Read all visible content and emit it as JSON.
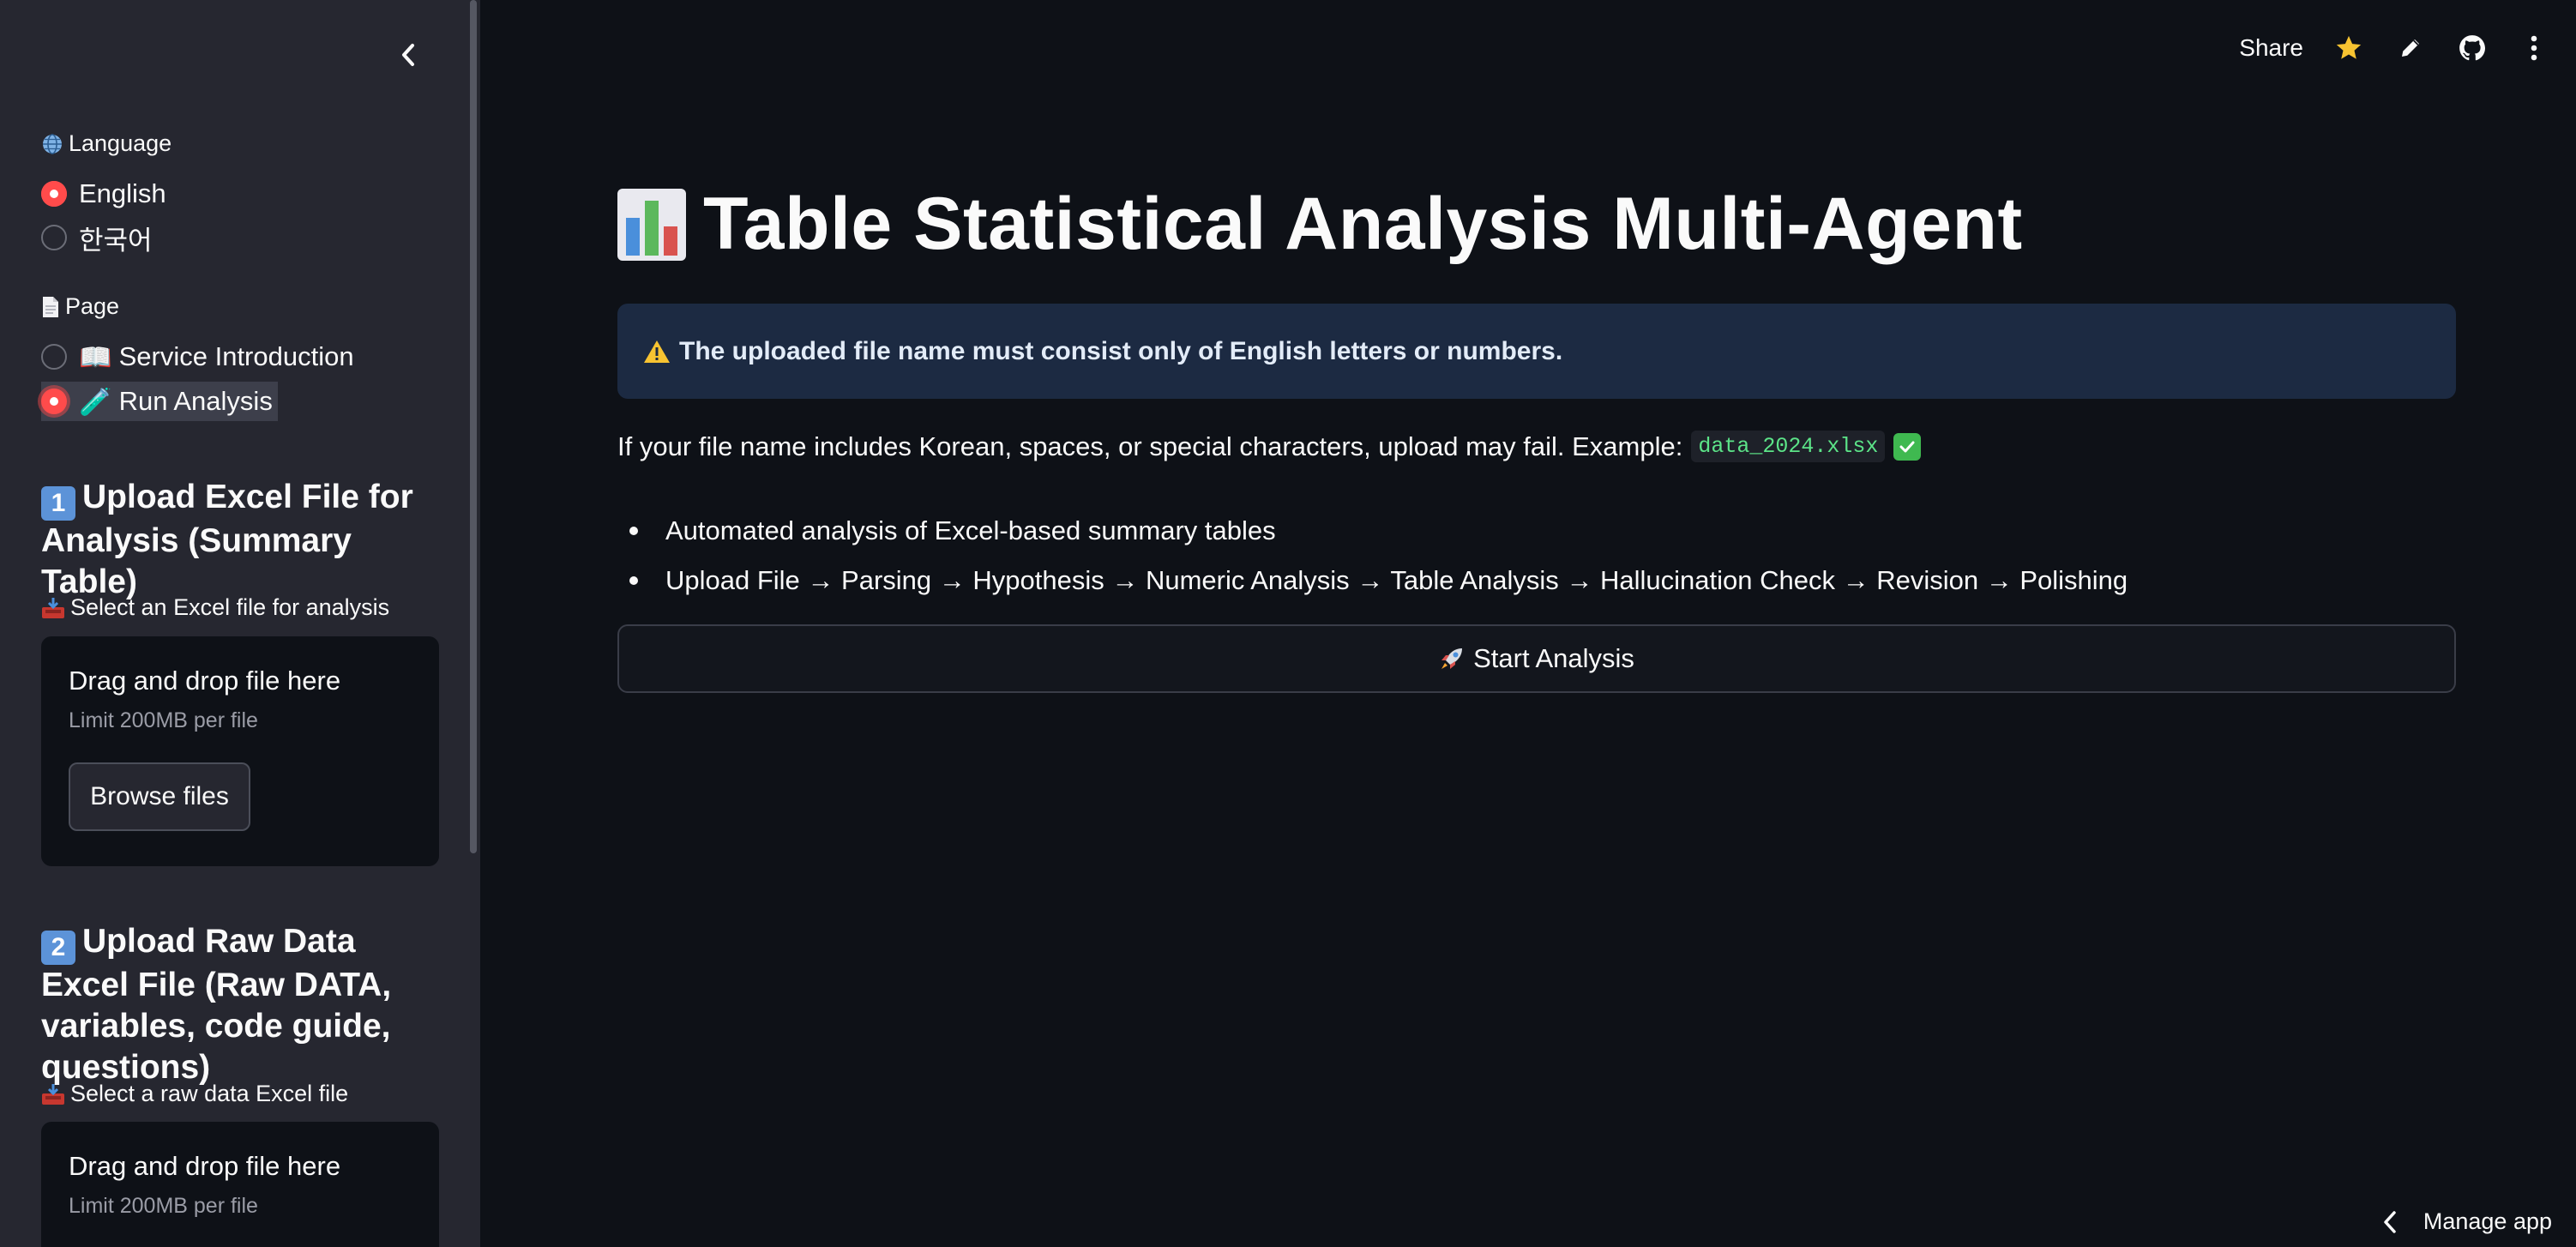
{
  "sidebar": {
    "language_label": "Language",
    "languages": [
      {
        "label": "English",
        "selected": true
      },
      {
        "label": "한국어",
        "selected": false
      }
    ],
    "page_label": "Page",
    "pages": [
      {
        "icon": "📖",
        "label": "Service Introduction",
        "selected": false
      },
      {
        "icon": "🧪",
        "label": "Run Analysis",
        "selected": true
      }
    ],
    "section1": {
      "number": "1",
      "heading": "Upload Excel File for Analysis (Summary Table)",
      "uploader_label": "Select an Excel file for analysis",
      "drop_text": "Drag and drop file here",
      "limit_text": "Limit 200MB per file",
      "browse_label": "Browse files"
    },
    "section2": {
      "number": "2",
      "heading": "Upload Raw Data Excel File (Raw DATA, variables, code guide, questions)",
      "uploader_label": "Select a raw data Excel file",
      "drop_text": "Drag and drop file here",
      "limit_text": "Limit 200MB per file"
    }
  },
  "topbar": {
    "share_label": "Share",
    "icons": [
      "star-icon",
      "edit-pencil-icon",
      "github-icon",
      "more-vertical-icon"
    ]
  },
  "main": {
    "title": "Table Statistical Analysis Multi-Agent",
    "warning": "The uploaded file name must consist only of English letters or numbers.",
    "info_text": "If your file name includes Korean, spaces, or special characters, upload may fail. Example:",
    "example_code": "data_2024.xlsx",
    "bullets": [
      "Automated analysis of Excel-based summary tables",
      "Upload File → Parsing → Hypothesis → Numeric Analysis → Table Analysis → Hallucination Check → Revision → Polishing"
    ],
    "start_button": "Start Analysis"
  },
  "footer": {
    "manage_label": "Manage app"
  },
  "colors": {
    "background": "#0e1117",
    "sidebar": "#262730",
    "accent": "#ff4b4b",
    "info_box": "#1c2a42",
    "code_text": "#5ce488"
  }
}
